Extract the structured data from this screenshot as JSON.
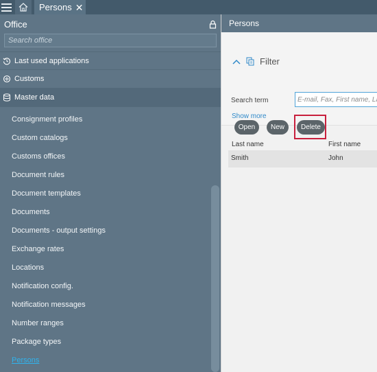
{
  "topbar": {
    "tab_label": "Persons",
    "tab_close": "✕"
  },
  "sidebar": {
    "title": "Office",
    "search_placeholder": "Search office",
    "sections": [
      {
        "label": "Last used applications",
        "icon": "history-icon"
      },
      {
        "label": "Customs",
        "icon": "customs-icon"
      },
      {
        "label": "Master data",
        "icon": "database-icon"
      }
    ],
    "items": [
      {
        "label": "Consignment profiles"
      },
      {
        "label": "Custom catalogs"
      },
      {
        "label": "Customs offices"
      },
      {
        "label": "Document rules"
      },
      {
        "label": "Document templates"
      },
      {
        "label": "Documents"
      },
      {
        "label": "Documents - output settings"
      },
      {
        "label": "Exchange rates"
      },
      {
        "label": "Locations"
      },
      {
        "label": "Notification config."
      },
      {
        "label": "Notification messages"
      },
      {
        "label": "Number ranges"
      },
      {
        "label": "Package types"
      },
      {
        "label": "Persons"
      }
    ],
    "selected_item": "Persons"
  },
  "main": {
    "title": "Persons",
    "filter_label": "Filter",
    "search_term_label": "Search term",
    "search_term_placeholder": "E-mail, Fax, First name, Last name",
    "show_more": "Show more",
    "buttons": {
      "open": "Open",
      "new": "New",
      "delete": "Delete"
    },
    "table": {
      "headers": [
        "Last name",
        "First name"
      ],
      "rows": [
        [
          "Smith",
          "John"
        ]
      ]
    }
  },
  "colors": {
    "sidebar_bg": "#5f7586",
    "topbar_bg": "#435a6b",
    "link_blue": "#2f89c9",
    "selected_item": "#2fb4ef",
    "highlight_border": "#c81e3c",
    "button_bg": "#5b6469"
  }
}
